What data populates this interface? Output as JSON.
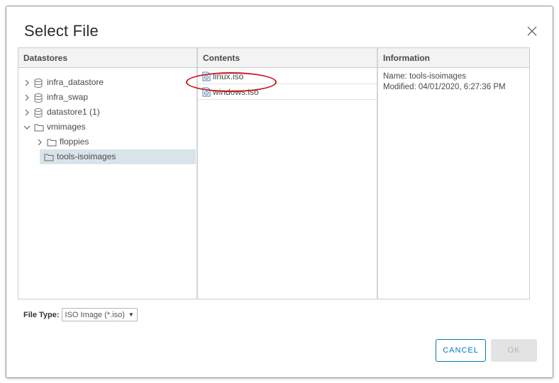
{
  "dialog": {
    "title": "Select File"
  },
  "datastores": {
    "header": "Datastores",
    "items": [
      {
        "label": "infra_datastore",
        "type": "datastore",
        "expanded": false,
        "level": 0
      },
      {
        "label": "infra_swap",
        "type": "datastore",
        "expanded": false,
        "level": 0
      },
      {
        "label": "datastore1 (1)",
        "type": "datastore",
        "expanded": false,
        "level": 0
      },
      {
        "label": "vmimages",
        "type": "folder",
        "expanded": true,
        "level": 0
      },
      {
        "label": "floppies",
        "type": "folder",
        "expanded": false,
        "level": 1
      },
      {
        "label": "tools-isoimages",
        "type": "folder",
        "expanded": false,
        "level": 1,
        "selected": true
      }
    ]
  },
  "contents": {
    "header": "Contents",
    "files": [
      {
        "label": "linux.iso"
      },
      {
        "label": "windows.iso"
      }
    ]
  },
  "information": {
    "header": "Information",
    "name_line": "Name: tools-isoimages",
    "modified_line": "Modified: 04/01/2020, 6:27:36 PM"
  },
  "file_type": {
    "label": "File Type:",
    "selected": "ISO Image (*.iso)"
  },
  "buttons": {
    "cancel": "CANCEL",
    "ok": "OK"
  },
  "colors": {
    "accent": "#0079b8",
    "selection": "#d9e4ea",
    "annotation": "#c4161c"
  }
}
